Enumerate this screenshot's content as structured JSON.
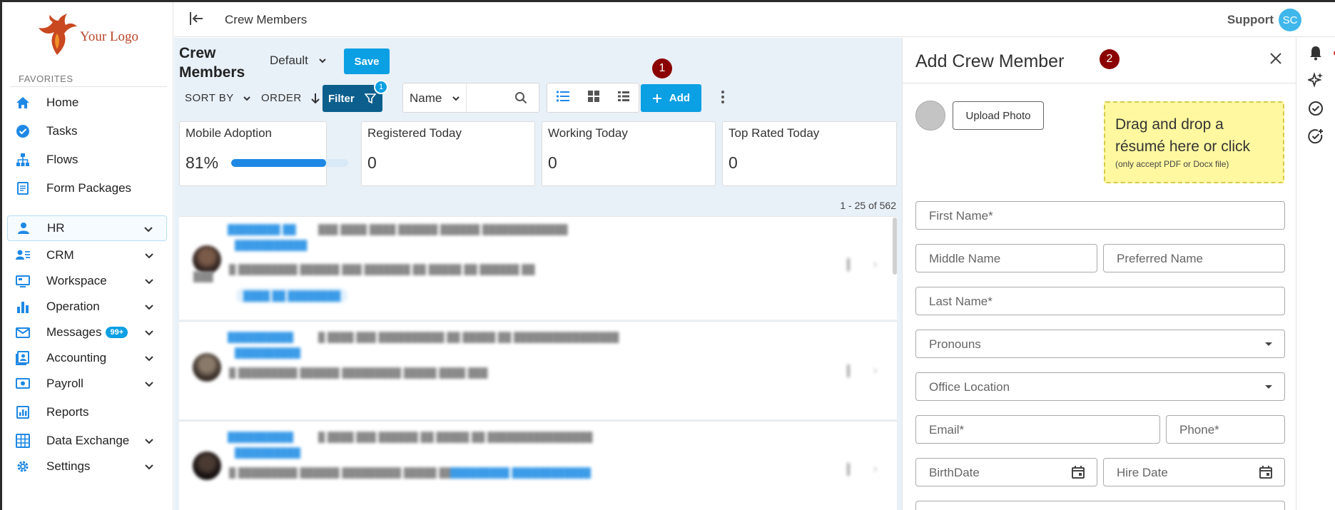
{
  "sidebar": {
    "logo_text": "Your Logo",
    "favorites_label": "FAVORITES",
    "items": [
      {
        "label": "Home",
        "icon": "home-icon"
      },
      {
        "label": "Tasks",
        "icon": "check-circle-icon"
      },
      {
        "label": "Flows",
        "icon": "hierarchy-icon"
      },
      {
        "label": "Form Packages",
        "icon": "form-icon"
      },
      {
        "label": "HR",
        "icon": "person-icon"
      },
      {
        "label": "CRM",
        "icon": "contacts-icon"
      },
      {
        "label": "Workspace",
        "icon": "workspace-icon"
      },
      {
        "label": "Operation",
        "icon": "bar-chart-icon"
      },
      {
        "label": "Messages",
        "icon": "mail-icon",
        "badge": "99+"
      },
      {
        "label": "Accounting",
        "icon": "accounting-icon"
      },
      {
        "label": "Payroll",
        "icon": "payroll-icon"
      },
      {
        "label": "Reports",
        "icon": "report-icon"
      },
      {
        "label": "Data Exchange",
        "icon": "grid-icon"
      },
      {
        "label": "Settings",
        "icon": "gear-icon"
      }
    ]
  },
  "topbar": {
    "title": "Crew Members",
    "support": "Support",
    "avatar_initials": "SC"
  },
  "main": {
    "page_title": "Crew Members",
    "view_select": "Default",
    "save_label": "Save",
    "sort_by_label": "SORT BY",
    "order_label": "ORDER",
    "filter_label": "Filter",
    "filter_count": "1",
    "search_field": "Name",
    "add_label": "Add",
    "step_badge_1": "1",
    "stats": [
      {
        "label": "Mobile Adoption",
        "value": "81%",
        "progress": 0.81
      },
      {
        "label": "Registered Today",
        "value": "0"
      },
      {
        "label": "Working Today",
        "value": "0"
      },
      {
        "label": "Top Rated Today",
        "value": "0"
      }
    ],
    "range_text": "1 - 25 of 562"
  },
  "panel": {
    "title": "Add Crew Member",
    "step_badge_2": "2",
    "upload_photo": "Upload Photo",
    "dropzone_main": "Drag and drop a résumé here or click",
    "dropzone_sub": "(only accept PDF or Docx file)",
    "fields": {
      "first_name": "First Name*",
      "middle_name": "Middle Name",
      "preferred_name": "Preferred Name",
      "last_name": "Last Name*",
      "pronouns": "Pronouns",
      "office_location": "Office Location",
      "email": "Email*",
      "phone": "Phone*",
      "birthdate": "BirthDate",
      "hire_date": "Hire Date"
    }
  },
  "colors": {
    "accent": "#0b9fe3",
    "filter_dark": "#0c5f8d",
    "step_badge": "#8b0000",
    "dropzone_bg": "#fff8a0",
    "main_bg": "#e8f0f8"
  }
}
